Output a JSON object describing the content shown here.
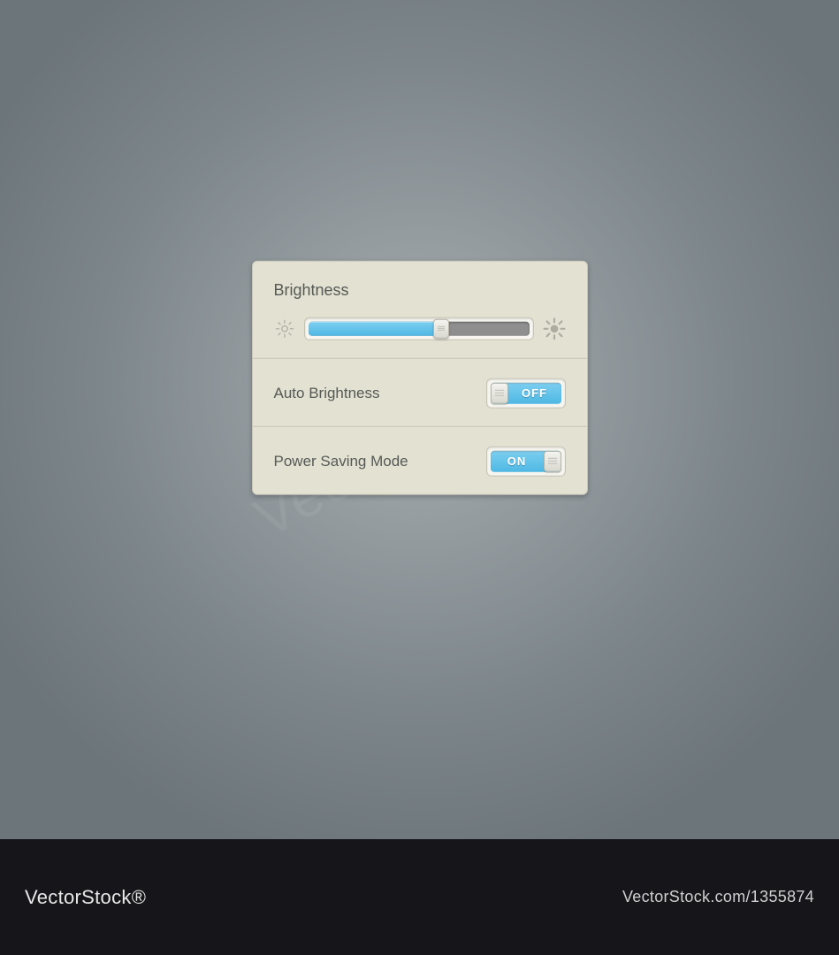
{
  "panel": {
    "brightness": {
      "title": "Brightness",
      "value_percent": 60,
      "low_icon": "brightness-low-icon",
      "high_icon": "brightness-high-icon"
    },
    "auto_brightness": {
      "label": "Auto Brightness",
      "state_text": "OFF",
      "is_on": false
    },
    "power_saving": {
      "label": "Power Saving Mode",
      "state_text": "ON",
      "is_on": true
    }
  },
  "footer": {
    "brand_left": "VectorStock®",
    "brand_right": "VectorStock.com/1355874"
  },
  "watermark": "VectorStock®",
  "colors": {
    "accent": "#55bde6",
    "panel_bg": "#e3e1d2",
    "text": "#555a55"
  }
}
